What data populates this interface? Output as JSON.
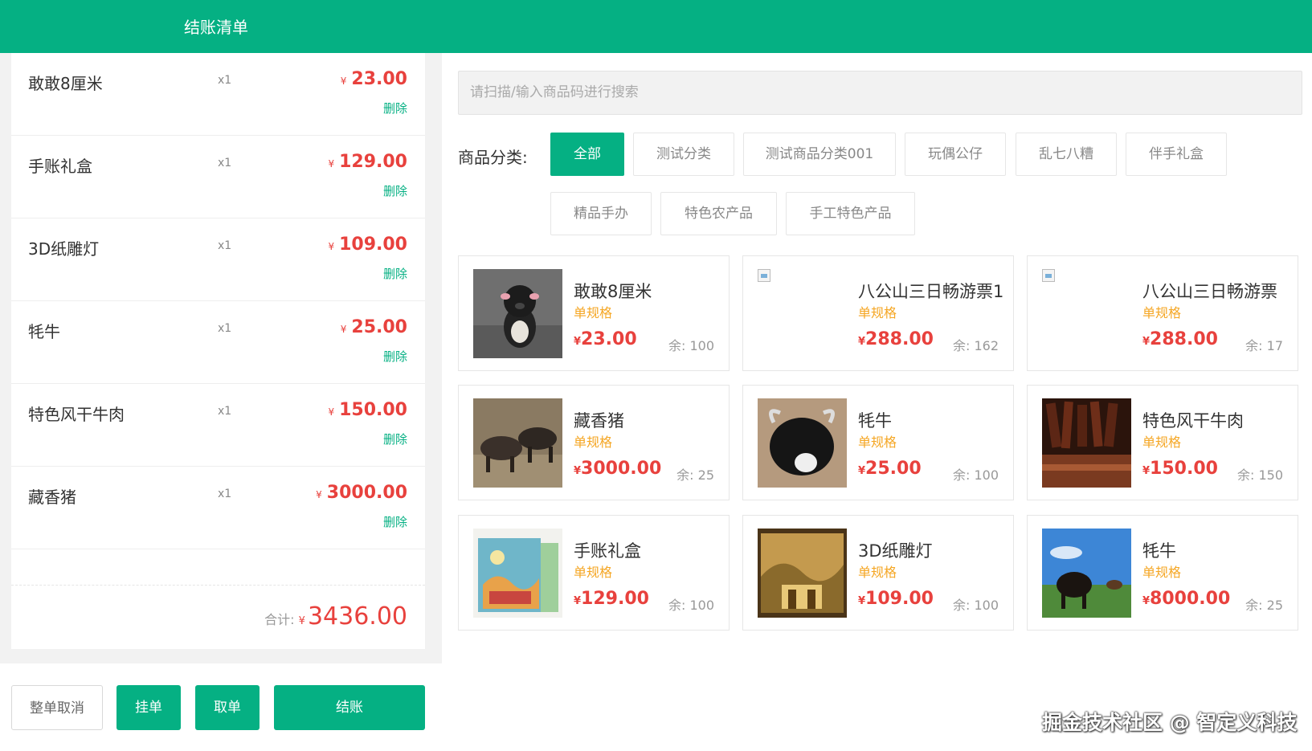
{
  "header": {
    "title": "结账清单"
  },
  "cart": {
    "delete_label": "删除",
    "items": [
      {
        "name": "敢敢8厘米",
        "qty": "x1",
        "price": "23.00"
      },
      {
        "name": "手账礼盒",
        "qty": "x1",
        "price": "129.00"
      },
      {
        "name": "3D纸雕灯",
        "qty": "x1",
        "price": "109.00"
      },
      {
        "name": "牦牛",
        "qty": "x1",
        "price": "25.00"
      },
      {
        "name": "特色风干牛肉",
        "qty": "x1",
        "price": "150.00"
      },
      {
        "name": "藏香猪",
        "qty": "x1",
        "price": "3000.00"
      }
    ],
    "currency": "¥",
    "total_label": "合计:",
    "total": "3436.00"
  },
  "actions": {
    "cancel_all": "整单取消",
    "hold": "挂单",
    "retrieve": "取单",
    "checkout": "结账"
  },
  "search": {
    "placeholder": "请扫描/输入商品码进行搜索"
  },
  "categories": {
    "label": "商品分类:",
    "items": [
      "全部",
      "测试分类",
      "测试商品分类001",
      "玩偶公仔",
      "乱七八糟",
      "伴手礼盒",
      "精品手办",
      "特色农产品",
      "手工特色产品"
    ],
    "active": "全部"
  },
  "products": {
    "spec_label": "单规格",
    "stock_prefix": "余:",
    "items": [
      {
        "name": "敢敢8厘米",
        "price": "23.00",
        "stock": "100",
        "icon": "pig-plush-image"
      },
      {
        "name": "八公山三日畅游票1",
        "price": "288.00",
        "stock": "162",
        "icon": "broken-image-icon"
      },
      {
        "name": "八公山三日畅游票",
        "price": "288.00",
        "stock": "17",
        "icon": "broken-image-icon"
      },
      {
        "name": "藏香猪",
        "price": "3000.00",
        "stock": "25",
        "icon": "pig-photo-image"
      },
      {
        "name": "牦牛",
        "price": "25.00",
        "stock": "100",
        "icon": "yak-plush-image"
      },
      {
        "name": "特色风干牛肉",
        "price": "150.00",
        "stock": "150",
        "icon": "dried-beef-image"
      },
      {
        "name": "手账礼盒",
        "price": "129.00",
        "stock": "100",
        "icon": "gift-box-image"
      },
      {
        "name": "3D纸雕灯",
        "price": "109.00",
        "stock": "100",
        "icon": "paper-lamp-image"
      },
      {
        "name": "牦牛",
        "price": "8000.00",
        "stock": "25",
        "icon": "yak-photo-image"
      }
    ]
  },
  "watermark": "掘金技术社区 @ 智定义科技",
  "colors": {
    "brand": "#05b083",
    "price": "#e8413d",
    "spec": "#f5a623"
  }
}
